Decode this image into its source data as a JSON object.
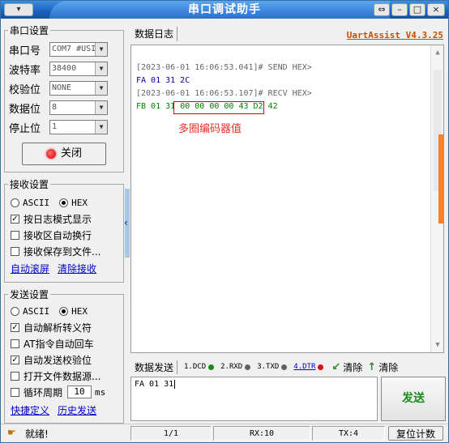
{
  "window": {
    "title": "串口调试助手",
    "sysmenu_icon": "app-menu-icon"
  },
  "serial_settings": {
    "legend": "串口设置",
    "port": {
      "label": "串口号",
      "value": "COM7 #USI"
    },
    "baud": {
      "label": "波特率",
      "value": "38400"
    },
    "parity": {
      "label": "校验位",
      "value": "NONE"
    },
    "databits": {
      "label": "数据位",
      "value": "8"
    },
    "stopbits": {
      "label": "停止位",
      "value": "1"
    },
    "close_button": "关闭"
  },
  "receive_settings": {
    "legend": "接收设置",
    "ascii": "ASCII",
    "hex": "HEX",
    "opt1": "按日志模式显示",
    "opt2": "接收区自动换行",
    "opt3": "接收保存到文件...",
    "link_scroll": "自动滚屏",
    "link_clear": "清除接收"
  },
  "send_settings": {
    "legend": "发送设置",
    "ascii": "ASCII",
    "hex": "HEX",
    "opt1": "自动解析转义符",
    "opt2": "AT指令自动回车",
    "opt3": "自动发送校验位",
    "opt4": "打开文件数据源...",
    "opt5_label": "循环周期",
    "opt5_value": "10",
    "opt5_unit": "ms",
    "link_shortcut": "快捷定义",
    "link_history": "历史发送"
  },
  "log": {
    "tab": "数据日志",
    "version": "UartAssist V4.3.25",
    "line1": "[2023-06-01 16:06:53.041]# SEND HEX>",
    "line2": "FA 01 31 2C",
    "line3": "[2023-06-01 16:06:53.107]# RECV HEX>",
    "line4_prefix": "FB 01 31",
    "line4_box": "00 00 00 00 43 D2",
    "line4_suffix": "42",
    "annotation": "多圈编码器值"
  },
  "send_bar": {
    "tab": "数据发送",
    "dcd": "1.DCD",
    "rxd": "2.RXD",
    "txd": "3.TXD",
    "dtr": "4.DTR",
    "clear": "清除",
    "clear2": "清除",
    "dot_colors": {
      "dcd": "#1a8a1a",
      "rxd": "#606060",
      "txd": "#606060",
      "dtr": "#d01010"
    }
  },
  "send_area": {
    "content": "FA 01 31",
    "button": "发送"
  },
  "status": {
    "ready": "就绪!",
    "pages": "1/1",
    "rx": "RX:10",
    "tx": "TX:4",
    "reset": "复位计数"
  }
}
